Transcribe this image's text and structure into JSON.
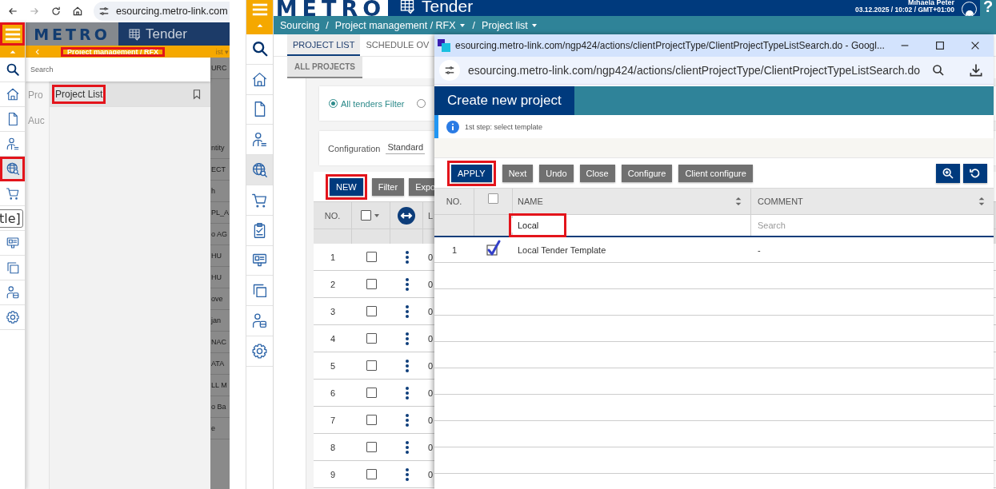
{
  "left_screenshot": {
    "browser": {
      "url": "esourcing.metro-link.com"
    },
    "header": {
      "logo": "METRO",
      "title": "Tender",
      "menu_highlighted": true
    },
    "rail": [
      {
        "selected": false,
        "highlighted": false
      },
      {
        "selected": false,
        "highlighted": false
      },
      {
        "selected": false,
        "highlighted": false
      },
      {
        "selected": false,
        "highlighted": false
      },
      {
        "selected": true,
        "highlighted": true
      },
      {
        "selected": false,
        "highlighted": false
      },
      {
        "selected": false,
        "highlighted": false
      },
      {
        "selected": false,
        "highlighted": false
      },
      {
        "selected": false,
        "highlighted": false
      },
      {
        "selected": false,
        "highlighted": false
      }
    ],
    "tooltip": "tle]",
    "drawer": {
      "breadcrumb": "Project management / RFX",
      "breadcrumb_highlighted": true,
      "behind_text": "ist ▾",
      "search": {
        "placeholder": "Search"
      },
      "categories": [
        "Pro",
        "Auc"
      ],
      "menu_items": [
        {
          "label": "Project List",
          "selected": true,
          "highlighted": true
        }
      ]
    },
    "background_fragments": [
      "URC",
      "ntity",
      "ECT",
      "h",
      "PL_A",
      "o AG",
      "HU",
      "HU",
      "ove",
      "jan",
      "NAC",
      "ATA",
      "LL M",
      "o Ba",
      "e"
    ]
  },
  "right_screenshot": {
    "header": {
      "logo": "METRO",
      "title": "Tender",
      "user": "Mihaela Peter",
      "datetime": "03.12.2025 / 10:02 / GMT+01:00",
      "help": "?"
    },
    "breadcrumb": {
      "separator": "/",
      "items": [
        {
          "label": "Sourcing",
          "dropdown": false
        },
        {
          "label": "Project management / RFX",
          "dropdown": true
        },
        {
          "label": "Project list",
          "dropdown": true
        }
      ]
    },
    "rail": [
      {
        "selected": false
      },
      {
        "selected": false
      },
      {
        "selected": false
      },
      {
        "selected": false
      },
      {
        "selected": true
      },
      {
        "selected": false
      },
      {
        "selected": false
      },
      {
        "selected": false
      },
      {
        "selected": false
      },
      {
        "selected": false
      },
      {
        "selected": false
      }
    ],
    "tabs": [
      {
        "label": "PROJECT LIST",
        "selected": true
      },
      {
        "label": "SCHEDULE OV",
        "selected": false
      }
    ],
    "subtabs": [
      {
        "label": "ALL PROJECTS",
        "selected": true
      }
    ],
    "filters": [
      {
        "label": "All tenders Filter",
        "selected": true
      },
      {
        "selected": false
      }
    ],
    "configuration": {
      "label": "Configuration",
      "value": "Standard"
    },
    "toolbar": [
      {
        "label": "NEW",
        "primary": true,
        "highlighted": true
      },
      {
        "label": "Filter",
        "primary": false,
        "highlighted": false
      },
      {
        "label": "Expo",
        "primary": false,
        "highlighted": false
      }
    ],
    "table": {
      "columns": [
        "NO.",
        "L"
      ],
      "select_all_checked": false,
      "rows": [
        {
          "no": "1",
          "checked": false,
          "column_4": "0"
        },
        {
          "no": "2",
          "checked": false,
          "column_4": "0"
        },
        {
          "no": "3",
          "checked": false,
          "column_4": "0"
        },
        {
          "no": "4",
          "checked": false,
          "column_4": "0"
        },
        {
          "no": "5",
          "checked": false,
          "column_4": "0"
        },
        {
          "no": "6",
          "checked": false,
          "column_4": "0"
        },
        {
          "no": "7",
          "checked": false,
          "column_4": "0"
        },
        {
          "no": "8",
          "checked": false,
          "column_4": "0"
        },
        {
          "no": "9",
          "checked": false,
          "column_4": "0"
        }
      ]
    },
    "popup": {
      "window_title": "esourcing.metro-link.com/ngp424/actions/clientProjectType/ClientProjectTypeListSearch.do - Googl...",
      "url": "esourcing.metro-link.com/ngp424/actions/clientProjectType/ClientProjectTypeListSearch.do",
      "title": "Create new project",
      "info": "1st step: select template",
      "buttons": [
        {
          "label": "APPLY",
          "primary": true,
          "highlighted": true
        },
        {
          "label": "Next",
          "primary": false,
          "highlighted": false
        },
        {
          "label": "Undo",
          "primary": false,
          "highlighted": false
        },
        {
          "label": "Close",
          "primary": false,
          "highlighted": false
        },
        {
          "label": "Configure",
          "primary": false,
          "highlighted": false
        },
        {
          "label": "Client configure",
          "primary": false,
          "highlighted": false
        }
      ],
      "table": {
        "columns": [
          "NO.",
          "NAME",
          "COMMENT"
        ],
        "select_all_checked": false,
        "filters": {
          "name": {
            "value": "Local",
            "highlighted": true
          },
          "comment": {
            "placeholder": "Search"
          }
        },
        "rows": [
          {
            "no": "1",
            "checked": true,
            "name": "Local Tender Template",
            "comment": "-"
          }
        ]
      }
    }
  }
}
